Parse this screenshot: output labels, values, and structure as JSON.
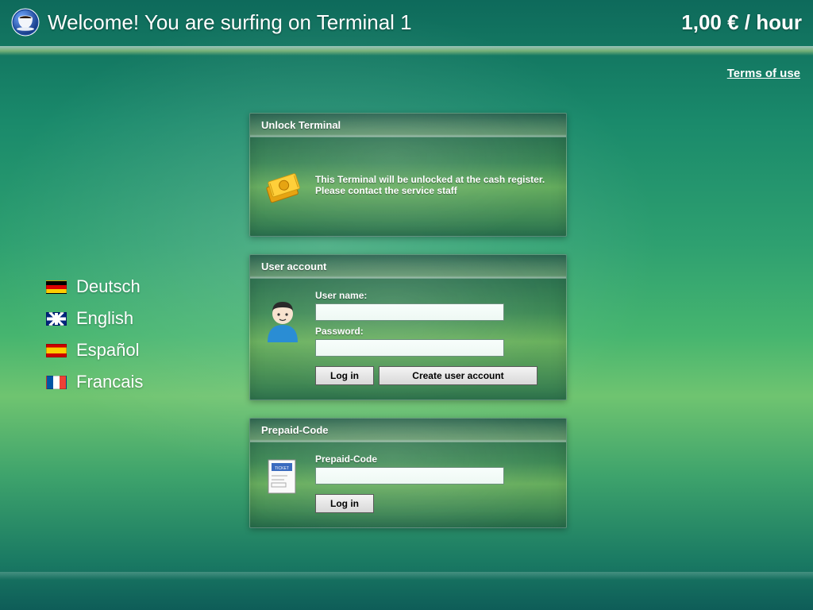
{
  "header": {
    "welcome": "Welcome! You are surfing on Terminal 1",
    "price": "1,00 € / hour"
  },
  "terms_link": "Terms of use",
  "languages": [
    {
      "code": "de",
      "label": "Deutsch"
    },
    {
      "code": "en",
      "label": "English"
    },
    {
      "code": "es",
      "label": "Español"
    },
    {
      "code": "fr",
      "label": "Francais"
    }
  ],
  "unlock": {
    "title": "Unlock Terminal",
    "message_line1": "This Terminal will be unlocked at the cash register.",
    "message_line2": "Please contact the service staff"
  },
  "account": {
    "title": "User account",
    "username_label": "User name:",
    "password_label": "Password:",
    "username_value": "",
    "password_value": "",
    "login_button": "Log in",
    "create_button": "Create user account"
  },
  "prepaid": {
    "title": "Prepaid-Code",
    "label": "Prepaid-Code",
    "value": "",
    "login_button": "Log in"
  }
}
